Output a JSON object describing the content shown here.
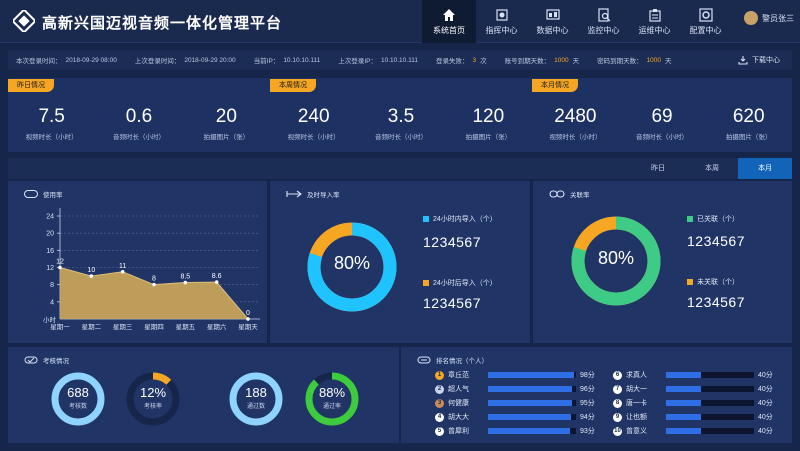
{
  "header": {
    "title": "高新兴国迈视音频一体化管理平台",
    "nav": [
      {
        "label": "系统首页",
        "icon": "home-icon",
        "active": true
      },
      {
        "label": "指挥中心",
        "icon": "command-icon",
        "active": false
      },
      {
        "label": "数据中心",
        "icon": "data-icon",
        "active": false
      },
      {
        "label": "监控中心",
        "icon": "monitor-icon",
        "active": false
      },
      {
        "label": "运维中心",
        "icon": "maintenance-icon",
        "active": false
      },
      {
        "label": "配置中心",
        "icon": "config-icon",
        "active": false
      }
    ],
    "user": "警员张三"
  },
  "info": {
    "this_login_label": "本次登录时间：",
    "this_login": "2018-09-29 08:00",
    "last_login_label": "上次登录时间：",
    "last_login": "2018-09-29 20:00",
    "current_ip_label": "当前IP：",
    "current_ip": "10.10.10.111",
    "last_ip_label": "上次登录IP：",
    "last_ip": "10.10.10.111",
    "login_fail_label": "登录失败：",
    "login_fail": "3",
    "login_fail_unit": "次",
    "account_expire_label": "账号到期天数：",
    "account_expire": "1000",
    "account_expire_unit": "天",
    "pwd_expire_label": "密码到期天数：",
    "pwd_expire": "1000",
    "pwd_expire_unit": "天",
    "download": "下载中心"
  },
  "stats": [
    {
      "tag": "昨日情况",
      "items": [
        {
          "value": "7.5",
          "label": "视频时长（小时）"
        },
        {
          "value": "0.6",
          "label": "音频时长（小时）"
        },
        {
          "value": "20",
          "label": "拍摄图片（张）"
        }
      ]
    },
    {
      "tag": "本周情况",
      "items": [
        {
          "value": "240",
          "label": "视频时长（小时）"
        },
        {
          "value": "3.5",
          "label": "音频时长（小时）"
        },
        {
          "value": "120",
          "label": "拍摄图片（张）"
        }
      ]
    },
    {
      "tag": "本月情况",
      "items": [
        {
          "value": "2480",
          "label": "视频时长（小时）"
        },
        {
          "value": "69",
          "label": "音频时长（小时）"
        },
        {
          "value": "620",
          "label": "拍摄图片（张）"
        }
      ]
    }
  ],
  "period_tabs": [
    {
      "label": "昨日",
      "active": false
    },
    {
      "label": "本周",
      "active": false
    },
    {
      "label": "本月",
      "active": true
    }
  ],
  "usage": {
    "title": "使用率",
    "unit_label": "小时",
    "chart_data": {
      "type": "area",
      "categories": [
        "星期一",
        "星期二",
        "星期三",
        "星期四",
        "星期五",
        "星期六",
        "星期天"
      ],
      "values": [
        12,
        10,
        11,
        8,
        8.5,
        8.6,
        0
      ],
      "ylim": [
        0,
        24
      ],
      "yticks": [
        4,
        8,
        12,
        16,
        20,
        24
      ],
      "color": "#cfa85a",
      "grid": true
    }
  },
  "import_rate": {
    "title": "及时导入率",
    "percent_text": "80%",
    "percent": 80,
    "colors": {
      "main": "#1ec3ff",
      "rest": "#f5a623"
    },
    "legend": [
      {
        "label": "24小时内导入（个）",
        "value": "1234567",
        "color": "#1ec3ff"
      },
      {
        "label": "24小时后导入（个）",
        "value": "1234567",
        "color": "#f5a623"
      }
    ]
  },
  "link_rate": {
    "title": "关联率",
    "percent_text": "80%",
    "percent": 80,
    "colors": {
      "main": "#3ecb86",
      "rest": "#f5a623"
    },
    "legend": [
      {
        "label": "已关联（个）",
        "value": "1234567",
        "color": "#3ecb86"
      },
      {
        "label": "未关联（个）",
        "value": "1234567",
        "color": "#f5a623"
      }
    ]
  },
  "assessment": {
    "title": "考核情况",
    "rings": [
      {
        "value": "688",
        "label": "考核数",
        "percent": 100,
        "color": "#8fd3ff"
      },
      {
        "value": "12%",
        "label": "考核率",
        "percent": 12,
        "color": "#f5a623"
      },
      {
        "value": "188",
        "label": "通过数",
        "percent": 100,
        "color": "#8fd3ff"
      },
      {
        "value": "88%",
        "label": "通过率",
        "percent": 88,
        "color": "#3ecb3e"
      }
    ]
  },
  "ranking": {
    "title": "排名情况（个人）",
    "left": [
      {
        "rank": "1",
        "name": "章丘范",
        "score": "98分",
        "percent": 98,
        "badge": "#f5a623"
      },
      {
        "rank": "2",
        "name": "超人气",
        "score": "96分",
        "percent": 96,
        "badge": "#c8d2ea"
      },
      {
        "rank": "3",
        "name": "何健康",
        "score": "95分",
        "percent": 95,
        "badge": "#c98b5a"
      },
      {
        "rank": "4",
        "name": "胡大大",
        "score": "94分",
        "percent": 94,
        "badge": "#ffffff"
      },
      {
        "rank": "5",
        "name": "曾犀利",
        "score": "93分",
        "percent": 93,
        "badge": "#ffffff"
      }
    ],
    "right": [
      {
        "rank": "6",
        "name": "求真人",
        "score": "40分",
        "percent": 40,
        "badge": "#ffffff"
      },
      {
        "rank": "7",
        "name": "胡大一",
        "score": "40分",
        "percent": 40,
        "badge": "#ffffff"
      },
      {
        "rank": "8",
        "name": "唐一卡",
        "score": "40分",
        "percent": 40,
        "badge": "#ffffff"
      },
      {
        "rank": "9",
        "name": "让也额",
        "score": "40分",
        "percent": 40,
        "badge": "#ffffff"
      },
      {
        "rank": "10",
        "name": "曾意义",
        "score": "40分",
        "percent": 40,
        "badge": "#ffffff"
      }
    ]
  }
}
